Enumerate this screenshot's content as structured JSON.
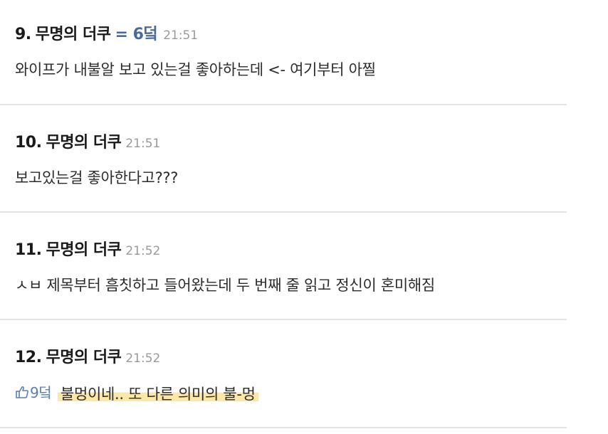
{
  "comments": [
    {
      "number": "9.",
      "author": "무명의 더쿠",
      "extra": "= 6덬",
      "time": "21:51",
      "body": "와이프가 내불알 보고 있는걸 좋아하는데 <- 여기부터 아찔"
    },
    {
      "number": "10.",
      "author": "무명의 더쿠",
      "time": "21:51",
      "body": "보고있는걸 좋아한다고???"
    },
    {
      "number": "11.",
      "author": "무명의 더쿠",
      "time": "21:52",
      "body": "ㅅㅂ 제목부터 흠칫하고 들어왔는데 두 번째 줄 읽고 정신이 혼미해짐"
    },
    {
      "number": "12.",
      "author": "무명의 더쿠",
      "time": "21:52",
      "reply_badge": "9덬",
      "body": "불멍이네.. 또 다른 의미의 불-멍"
    }
  ],
  "colors": {
    "reply_ref": "#4a6a9c",
    "highlight": "#fbe7a7",
    "divider": "#e3e3e3"
  }
}
